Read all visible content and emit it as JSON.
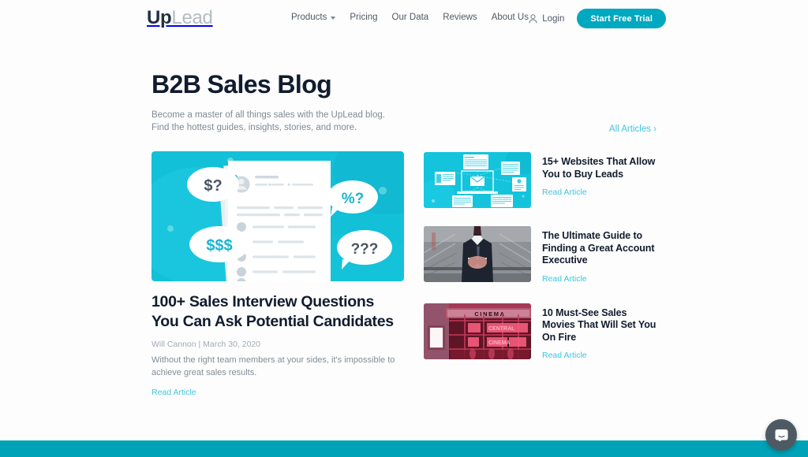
{
  "header": {
    "logo": {
      "primary": "Up",
      "secondary": "Lead"
    },
    "nav": [
      {
        "label": "Products",
        "has_dropdown": true,
        "icon": "chevron-down-icon"
      },
      {
        "label": "Pricing",
        "has_dropdown": false
      },
      {
        "label": "Our Data",
        "has_dropdown": false
      },
      {
        "label": "Reviews",
        "has_dropdown": false
      },
      {
        "label": "About Us",
        "has_dropdown": false
      }
    ],
    "login": {
      "label": "Login",
      "icon": "person-icon"
    },
    "cta": {
      "label": "Start Free Trial"
    }
  },
  "main": {
    "title": "B2B Sales Blog",
    "subtitle": "Become a master of all things sales with the UpLead blog. Find the hottest guides, insights, stories, and more.",
    "all_articles_label": "All Articles ›",
    "featured": {
      "title": "100+ Sales Interview Questions You Can Ask Potential Candidates",
      "author": "Will Cannon",
      "date": "March 30, 2020",
      "byline": "Will Cannon | March 30, 2020",
      "excerpt": "Without the right team members at your sides, it's impossible to achieve great sales results.",
      "read_label": "Read Article",
      "image": {
        "alt": "Illustration of a resume document surrounded by speech bubbles",
        "background": "#12c0d8",
        "bubbles": [
          "$?",
          "$$$",
          "%?",
          "???"
        ]
      }
    },
    "side_articles": [
      {
        "title": "15+ Websites That Allow You to Buy Leads",
        "read_label": "Read Article",
        "image": {
          "alt": "Laptop with email icon and floating browser windows",
          "background": "#13c4dc"
        }
      },
      {
        "title": "The Ultimate Guide to Finding a Great Account Executive",
        "read_label": "Read Article",
        "image": {
          "alt": "Businessman in dark suit with hands clasped",
          "background": "#555c63"
        }
      },
      {
        "title": "10 Must-See Sales Movies That Will Set You On Fire",
        "read_label": "Read Article",
        "image": {
          "alt": "Red-lit cinema storefront with CINEMA marquee",
          "background": "#b3264d",
          "sign_text": "CINEMA"
        }
      }
    ]
  },
  "footer": {
    "bar_color": "#00a2b8"
  },
  "chat": {
    "icon": "chat-bubble-icon",
    "label": "Open chat"
  },
  "theme": {
    "accent": "#00a8c0",
    "link": "#3ec6e0",
    "heading": "#111c2e",
    "body_text": "#7f8a95",
    "page_background": "#fdfdfd"
  }
}
